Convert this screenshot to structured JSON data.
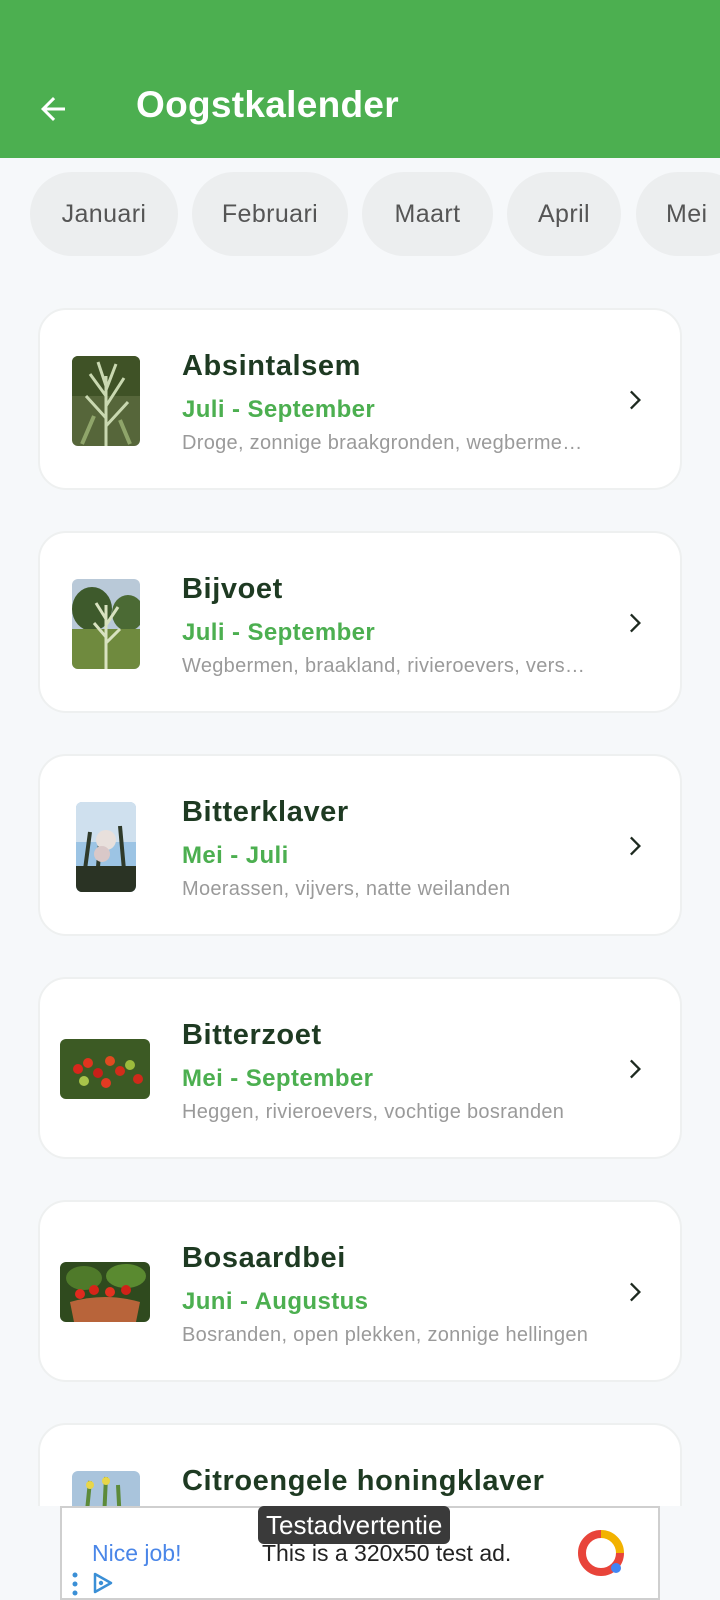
{
  "appbar": {
    "title": "Oogstkalender",
    "back_icon": "arrow-left-icon"
  },
  "months": [
    "Januari",
    "Februari",
    "Maart",
    "April",
    "Mei"
  ],
  "plants": [
    {
      "name": "Absintalsem",
      "period": "Juli - September",
      "habitat": "Droge, zonnige braakgronden, wegbermen, rotsige hellingen"
    },
    {
      "name": "Bijvoet",
      "period": "Juli - September",
      "habitat": "Wegbermen, braakland, rivieroevers, verstoorde grond"
    },
    {
      "name": "Bitterklaver",
      "period": "Mei - Juli",
      "habitat": "Moerassen, vijvers, natte weilanden"
    },
    {
      "name": "Bitterzoet",
      "period": "Mei - September",
      "habitat": "Heggen, rivieroevers, vochtige bosranden"
    },
    {
      "name": "Bosaardbei",
      "period": "Juni - Augustus",
      "habitat": "Bosranden, open plekken, zonnige hellingen"
    },
    {
      "name": "Citroengele honingklaver",
      "period": "",
      "habitat": ""
    }
  ],
  "ad": {
    "badge": "Testadvertentie",
    "nice": "Nice job!",
    "text": "This is a 320x50 test ad."
  },
  "colors": {
    "primary": "#4caf50",
    "title_dark": "#1e3a22"
  }
}
